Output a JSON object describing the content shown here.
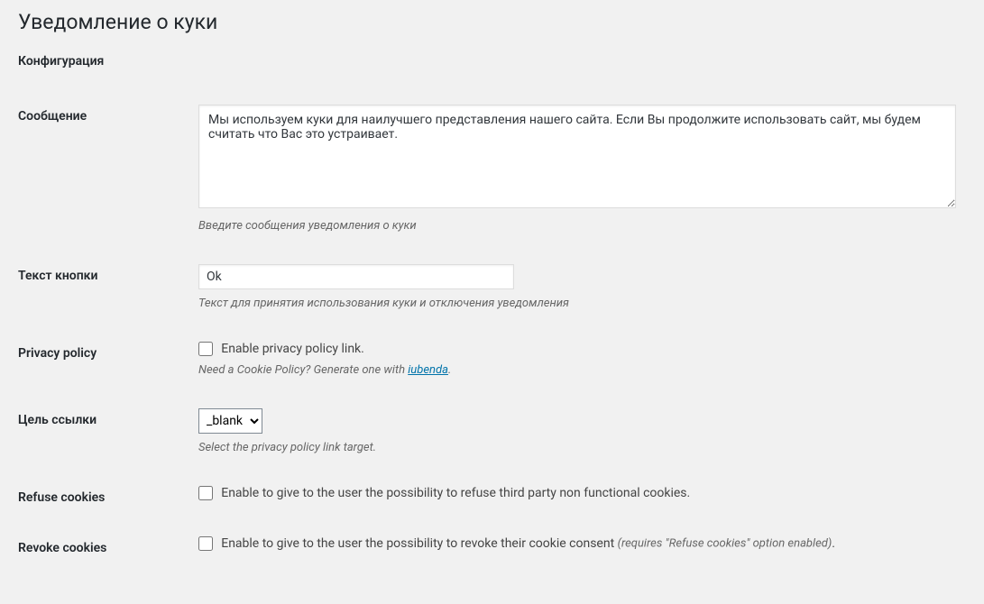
{
  "page": {
    "title": "Уведомление о куки",
    "section_title": "Конфигурация"
  },
  "fields": {
    "message": {
      "label": "Сообщение",
      "value": "Мы используем куки для наилучшего представления нашего сайта. Если Вы продолжите использовать сайт, мы будем считать что Вас это устраивает.",
      "description": "Введите сообщения уведомления о куки"
    },
    "button_text": {
      "label": "Текст кнопки",
      "value": "Ok",
      "description": "Текст для принятия использования куки и отключения уведомления"
    },
    "privacy_policy": {
      "label": "Privacy policy",
      "checkbox_label": "Enable privacy policy link.",
      "description_prefix": "Need a Cookie Policy? Generate one with ",
      "link_text": "iubenda",
      "description_suffix": "."
    },
    "link_target": {
      "label": "Цель ссылки",
      "value": "_blank",
      "description": "Select the privacy policy link target."
    },
    "refuse_cookies": {
      "label": "Refuse cookies",
      "checkbox_label": "Enable to give to the user the possibility to refuse third party non functional cookies."
    },
    "revoke_cookies": {
      "label": "Revoke cookies",
      "checkbox_label": "Enable to give to the user the possibility to revoke their cookie consent ",
      "note": "(requires \"Refuse cookies\" option enabled)",
      "suffix": "."
    }
  }
}
